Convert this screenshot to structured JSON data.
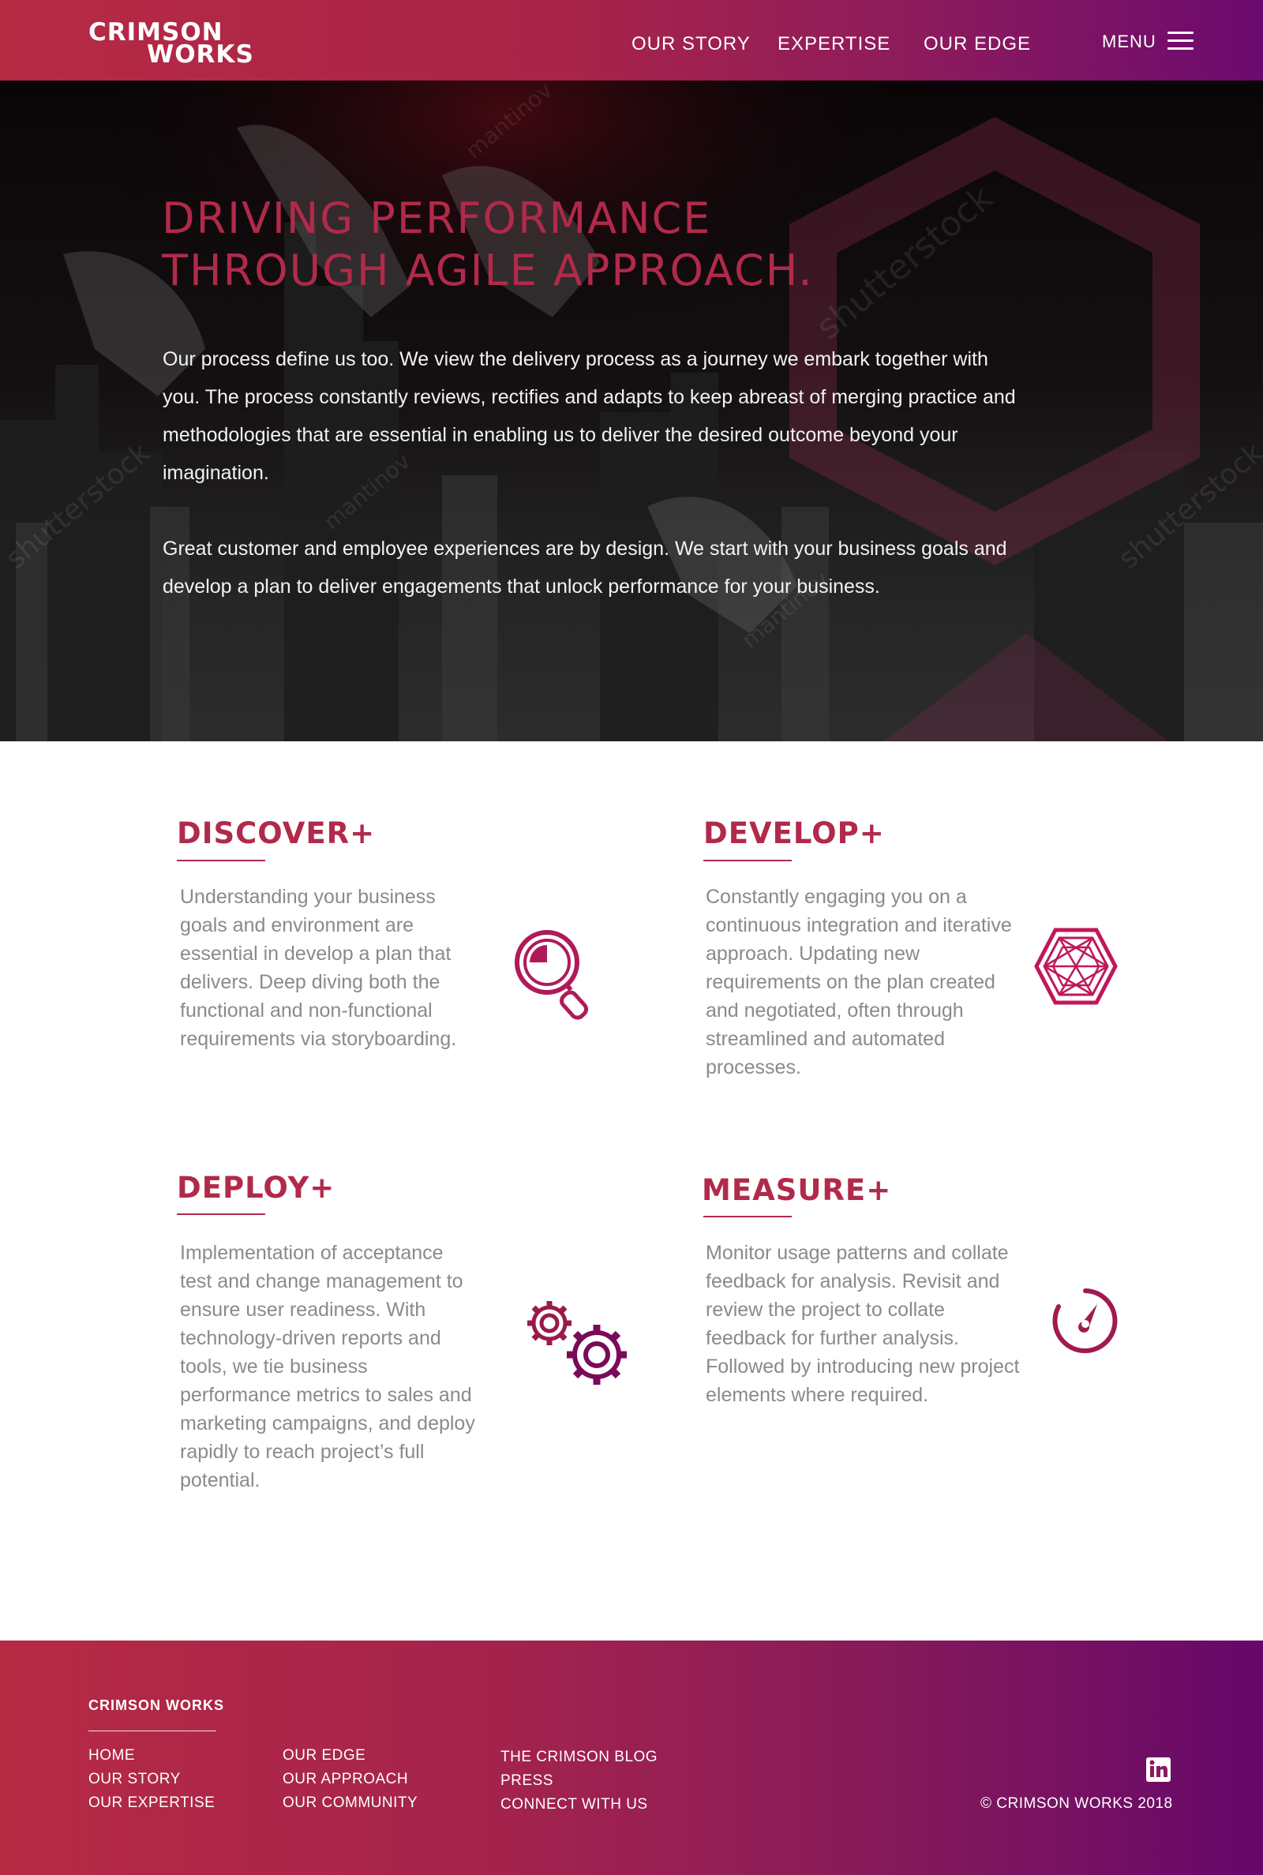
{
  "header": {
    "logo_line1": "CRIMSON",
    "logo_line2": "WORKS",
    "nav": [
      "OUR STORY",
      "EXPERTISE",
      "OUR EDGE"
    ],
    "menu_label": "MENU",
    "menu_icon": "hamburger-icon"
  },
  "hero": {
    "title_line1": "DRIVING PERFORMANCE",
    "title_line2": "THROUGH AGILE APPROACH.",
    "paragraph1": "Our process define us too. We view the delivery process as a journey we embark together with you. The process constantly reviews, rectifies and adapts to keep abreast of merging practice and methodologies that are essential in enabling us to deliver the desired outcome beyond your imagination.",
    "paragraph2": "Great customer and employee experiences are by design. We start with your business goals and develop a plan to deliver engagements that unlock performance for your business."
  },
  "services": [
    {
      "title": "DISCOVER+",
      "text": "Understanding your business goals and environment are essential in develop a plan that delivers. Deep diving both the functional and non-functional requirements via storyboarding.",
      "icon": "magnifier-icon"
    },
    {
      "title": "DEVELOP+",
      "text": "Constantly engaging you on a continuous integration and iterative approach. Updating new requirements on the plan created and negotiated, often through streamlined and automated processes.",
      "icon": "hexagon-network-icon"
    },
    {
      "title": "DEPLOY+",
      "text": "Implementation of acceptance test and change management to ensure user readiness. With technology-driven reports and tools, we tie business performance metrics to sales and marketing campaigns, and deploy rapidly to reach project’s full potential.",
      "icon": "gears-icon"
    },
    {
      "title": "MEASURE+",
      "text": "Monitor usage patterns and collate feedback for analysis. Revisit and review the project to collate feedback for further analysis.  Followed by introducing new project elements where required.",
      "icon": "gauge-icon"
    }
  ],
  "footer": {
    "brand": "CRIMSON WORKS",
    "col1": [
      "HOME",
      "OUR STORY",
      "OUR EXPERTISE"
    ],
    "col2": [
      "OUR EDGE",
      "OUR APPROACH",
      "OUR COMMUNITY"
    ],
    "col3": [
      "THE CRIMSON BLOG",
      "PRESS",
      "CONNECT WITH US"
    ],
    "social_icon": "linkedin-icon",
    "copyright": "© CRIMSON WORKS 2018"
  },
  "colors": {
    "accent": "#b12a4a",
    "gradient_start": "#b62a44",
    "gradient_end": "#6b0a6e",
    "body_text": "#8a8a8a"
  }
}
